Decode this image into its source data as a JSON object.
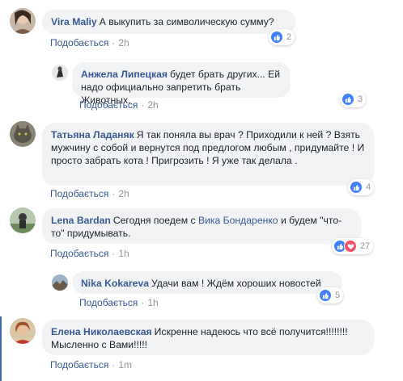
{
  "action_label": "Подобається",
  "separator": "·",
  "colors": {
    "link": "#385898",
    "bubble": "#f2f3f5",
    "like": "#4080ff",
    "love": "#f25268",
    "meta": "#90949c"
  },
  "comments": [
    {
      "author": "Vira Maliy",
      "text": "А выкупить за символическую сумму?",
      "time": "2h",
      "reactions": "2"
    },
    {
      "author": "Анжела Липецкая",
      "text": "будет брать других... Ей надо официально запретить брать Животных.",
      "time": "2h",
      "reactions": "3"
    },
    {
      "author": "Татьяна Ладаняк",
      "text": "Я так поняла вы врач ? Приходили к ней ? Взять мужчину с собой и вернутся под предлогом любым , придумайте ! И просто забрать кота ! Пригрозить ! Я уже так делала .",
      "time": "2h",
      "reactions": "4"
    },
    {
      "author": "Lena Bardan",
      "text_before": "Сегодня поедем с",
      "mention": "Вика Бондаренко",
      "text_after": "и будем \"что-то\" придумывать.",
      "time": "1h",
      "reactions": "27"
    },
    {
      "author": "Nika Kokareva",
      "text": "Удачи вам ! Ждём хороших новостей",
      "time": "1h",
      "reactions": "5"
    },
    {
      "author": "Елена Николаевская",
      "text": "Искренне надеюсь что всё получится!!!!!!!! Мысленно с Вами!!!!!",
      "time": "1m"
    }
  ]
}
